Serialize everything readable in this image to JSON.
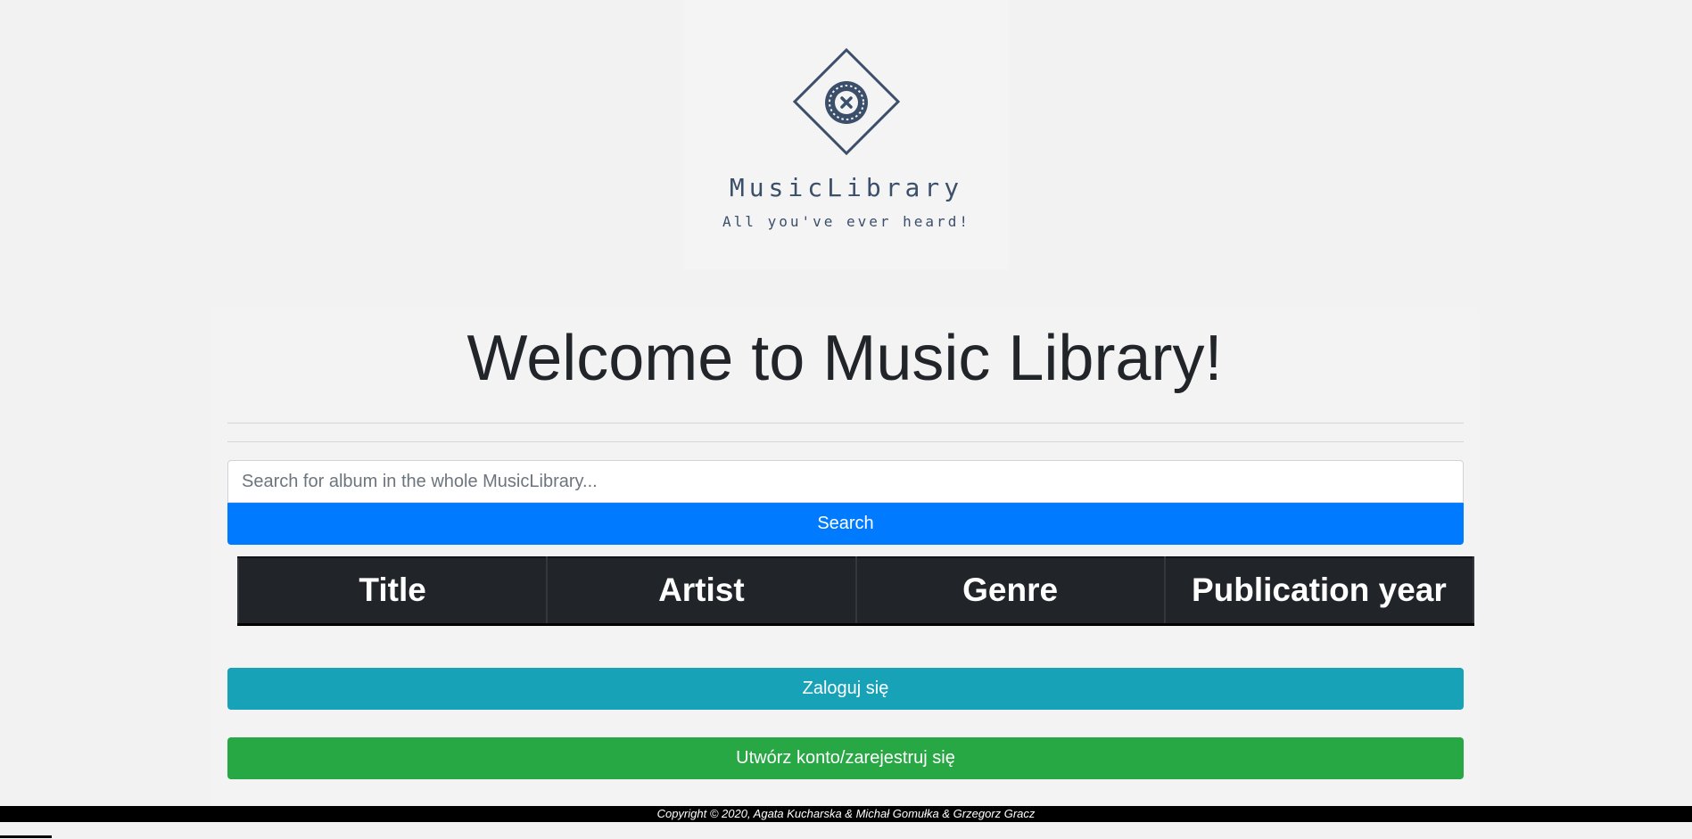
{
  "logo": {
    "icon": "vinyl-record-icon",
    "name": "MusicLibrary",
    "tagline": "All you've ever heard!"
  },
  "main": {
    "heading": "Welcome to Music Library!"
  },
  "search": {
    "placeholder": "Search for album in the whole MusicLibrary...",
    "button_label": "Search"
  },
  "table": {
    "columns": [
      "Title",
      "Artist",
      "Genre",
      "Publication year"
    ],
    "rows": []
  },
  "actions": {
    "login_label": "Zaloguj się",
    "register_label": "Utwórz konto/zarejestruj się"
  },
  "footer": {
    "copyright": "Copyright © 2020, Agata Kucharska & Michał Gomułka & Grzegorz Gracz"
  },
  "colors": {
    "background": "#f2f2f2",
    "brand": "#3b4f6b",
    "search_button": "#007bff",
    "login_button": "#17a2b8",
    "register_button": "#28a745",
    "table_header": "#212529"
  }
}
